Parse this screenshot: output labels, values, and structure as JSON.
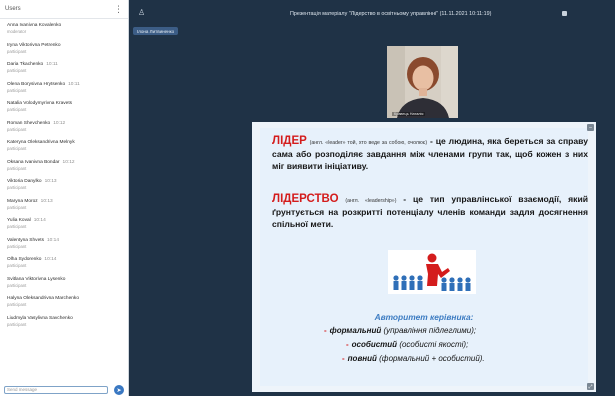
{
  "sidebar": {
    "header": "Users",
    "participants": [
      {
        "name": "Anna Ivanivna Kovalenko",
        "time": "",
        "status": "moderator"
      },
      {
        "name": "Iryna Viktorivna Petrenko",
        "time": "",
        "status": "participant"
      },
      {
        "name": "Daria Tkachenko",
        "time": "10:11",
        "status": "participant"
      },
      {
        "name": "Olena Borysivna Hrytsenko",
        "time": "10:11",
        "status": "participant"
      },
      {
        "name": "Natalia Volodymyrivna Kravets",
        "time": "",
        "status": "participant"
      },
      {
        "name": "Roman Shevchenko",
        "time": "10:12",
        "status": "participant"
      },
      {
        "name": "Kateryna Oleksandrivna Melnyk",
        "time": "",
        "status": "participant"
      },
      {
        "name": "Oksana Ivanivna Bondar",
        "time": "10:12",
        "status": "participant"
      },
      {
        "name": "Viktoria Danylko",
        "time": "10:13",
        "status": "participant"
      },
      {
        "name": "Maryna Moroz",
        "time": "10:13",
        "status": "participant"
      },
      {
        "name": "Yulia Koval",
        "time": "10:14",
        "status": "participant"
      },
      {
        "name": "Valentyna Shvets",
        "time": "10:14",
        "status": "participant"
      },
      {
        "name": "Olha Sydorenko",
        "time": "10:14",
        "status": "participant"
      },
      {
        "name": "Svitlana Viktorivna Lysenko",
        "time": "",
        "status": "participant"
      },
      {
        "name": "Halyna Oleksandrivna Marchenko",
        "time": "",
        "status": "participant"
      },
      {
        "name": "Liudmyla Vasylivna Savchenko",
        "time": "",
        "status": "participant"
      }
    ],
    "chat_placeholder": "Send message",
    "send_label": "➤"
  },
  "topbar": {
    "title": "Презентація матеріалу \"Лідерство в освітньому управлінні\" (11.11.2021 10:11:19)",
    "presenter_chip": "Ілона Литвиненко"
  },
  "webcam": {
    "label": "Кравець Наталія"
  },
  "slide": {
    "p1_term": "ЛІДЕР",
    "p1_etym": "(англ. «leader» той, хто веде за собою, очолює)",
    "p1_text": "- це людина, яка береться за справу сама або розподіляє завдання між членами групи так, щоб кожен з них міг виявити ініціативу.",
    "p2_term": "ЛІДЕРСТВО",
    "p2_etym": "(англ. «leadership»)",
    "p2_text": "- це тип управлінської взаємодії, який ґрунтується на розкритті потенціалу членів команди задля досягнення спільної мети.",
    "auth_title": "Авторитет керівника:",
    "auth_items": [
      {
        "bullet": "-",
        "keyword": "формальний",
        "note": "(управління підлеглими);"
      },
      {
        "bullet": "-",
        "keyword": "особистий",
        "note": "(особисті якості);"
      },
      {
        "bullet": "-",
        "keyword": "повний",
        "note": "(формальний + особистий)."
      }
    ]
  },
  "colors": {
    "background": "#1f3246",
    "term_red": "#d41c1c",
    "auth_blue": "#3d7cc2",
    "chip_blue": "#3c5d86"
  }
}
